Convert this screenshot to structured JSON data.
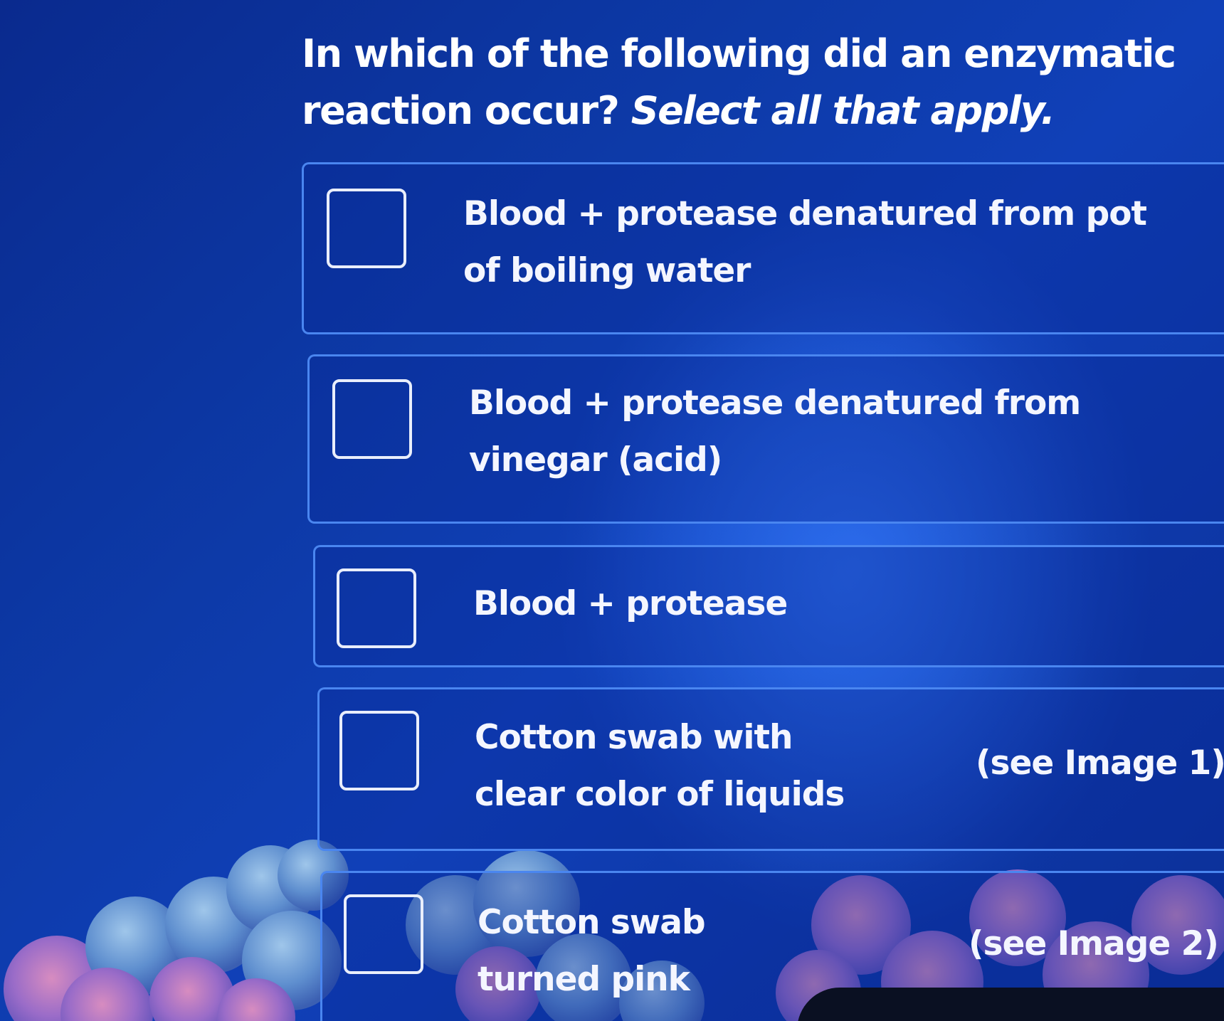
{
  "question": {
    "text": "In which of the following did an enzymatic reaction occur?",
    "instruction": "Select all that apply."
  },
  "options": [
    {
      "label": "Blood + protease denatured from pot of boiling water",
      "aside": "",
      "checked": false
    },
    {
      "label": "Blood + protease denatured from vinegar (acid)",
      "aside": "",
      "checked": false
    },
    {
      "label": "Blood + protease",
      "aside": "",
      "checked": false
    },
    {
      "label": "Cotton swab with clear color of liquids",
      "aside": "(see Image 1)",
      "checked": false
    },
    {
      "label": "Cotton swab turned pink",
      "aside": "(see Image 2)",
      "checked": false
    }
  ],
  "colors": {
    "background": "#0d3aa8",
    "option_border": "#4a86f0",
    "text": "#ffffff"
  }
}
